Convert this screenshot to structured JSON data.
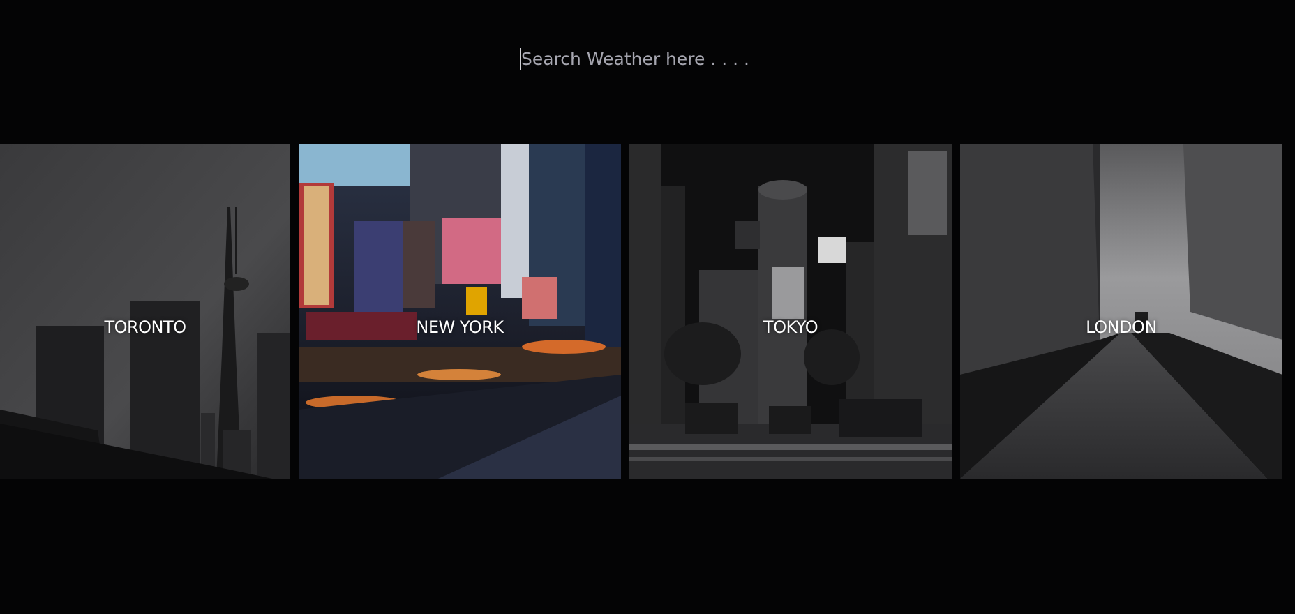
{
  "search": {
    "placeholder": "Search Weather here . . . .",
    "value": ""
  },
  "cities": [
    {
      "name": "TORONTO",
      "image_icon": "toronto-skyline-image"
    },
    {
      "name": "NEW YORK",
      "image_icon": "new-york-times-square-image"
    },
    {
      "name": "TOKYO",
      "image_icon": "tokyo-shibuya-image"
    },
    {
      "name": "LONDON",
      "image_icon": "london-street-image"
    }
  ],
  "colors": {
    "background": "#040405",
    "label": "#ffffff",
    "placeholder": "#a6a6b0"
  }
}
